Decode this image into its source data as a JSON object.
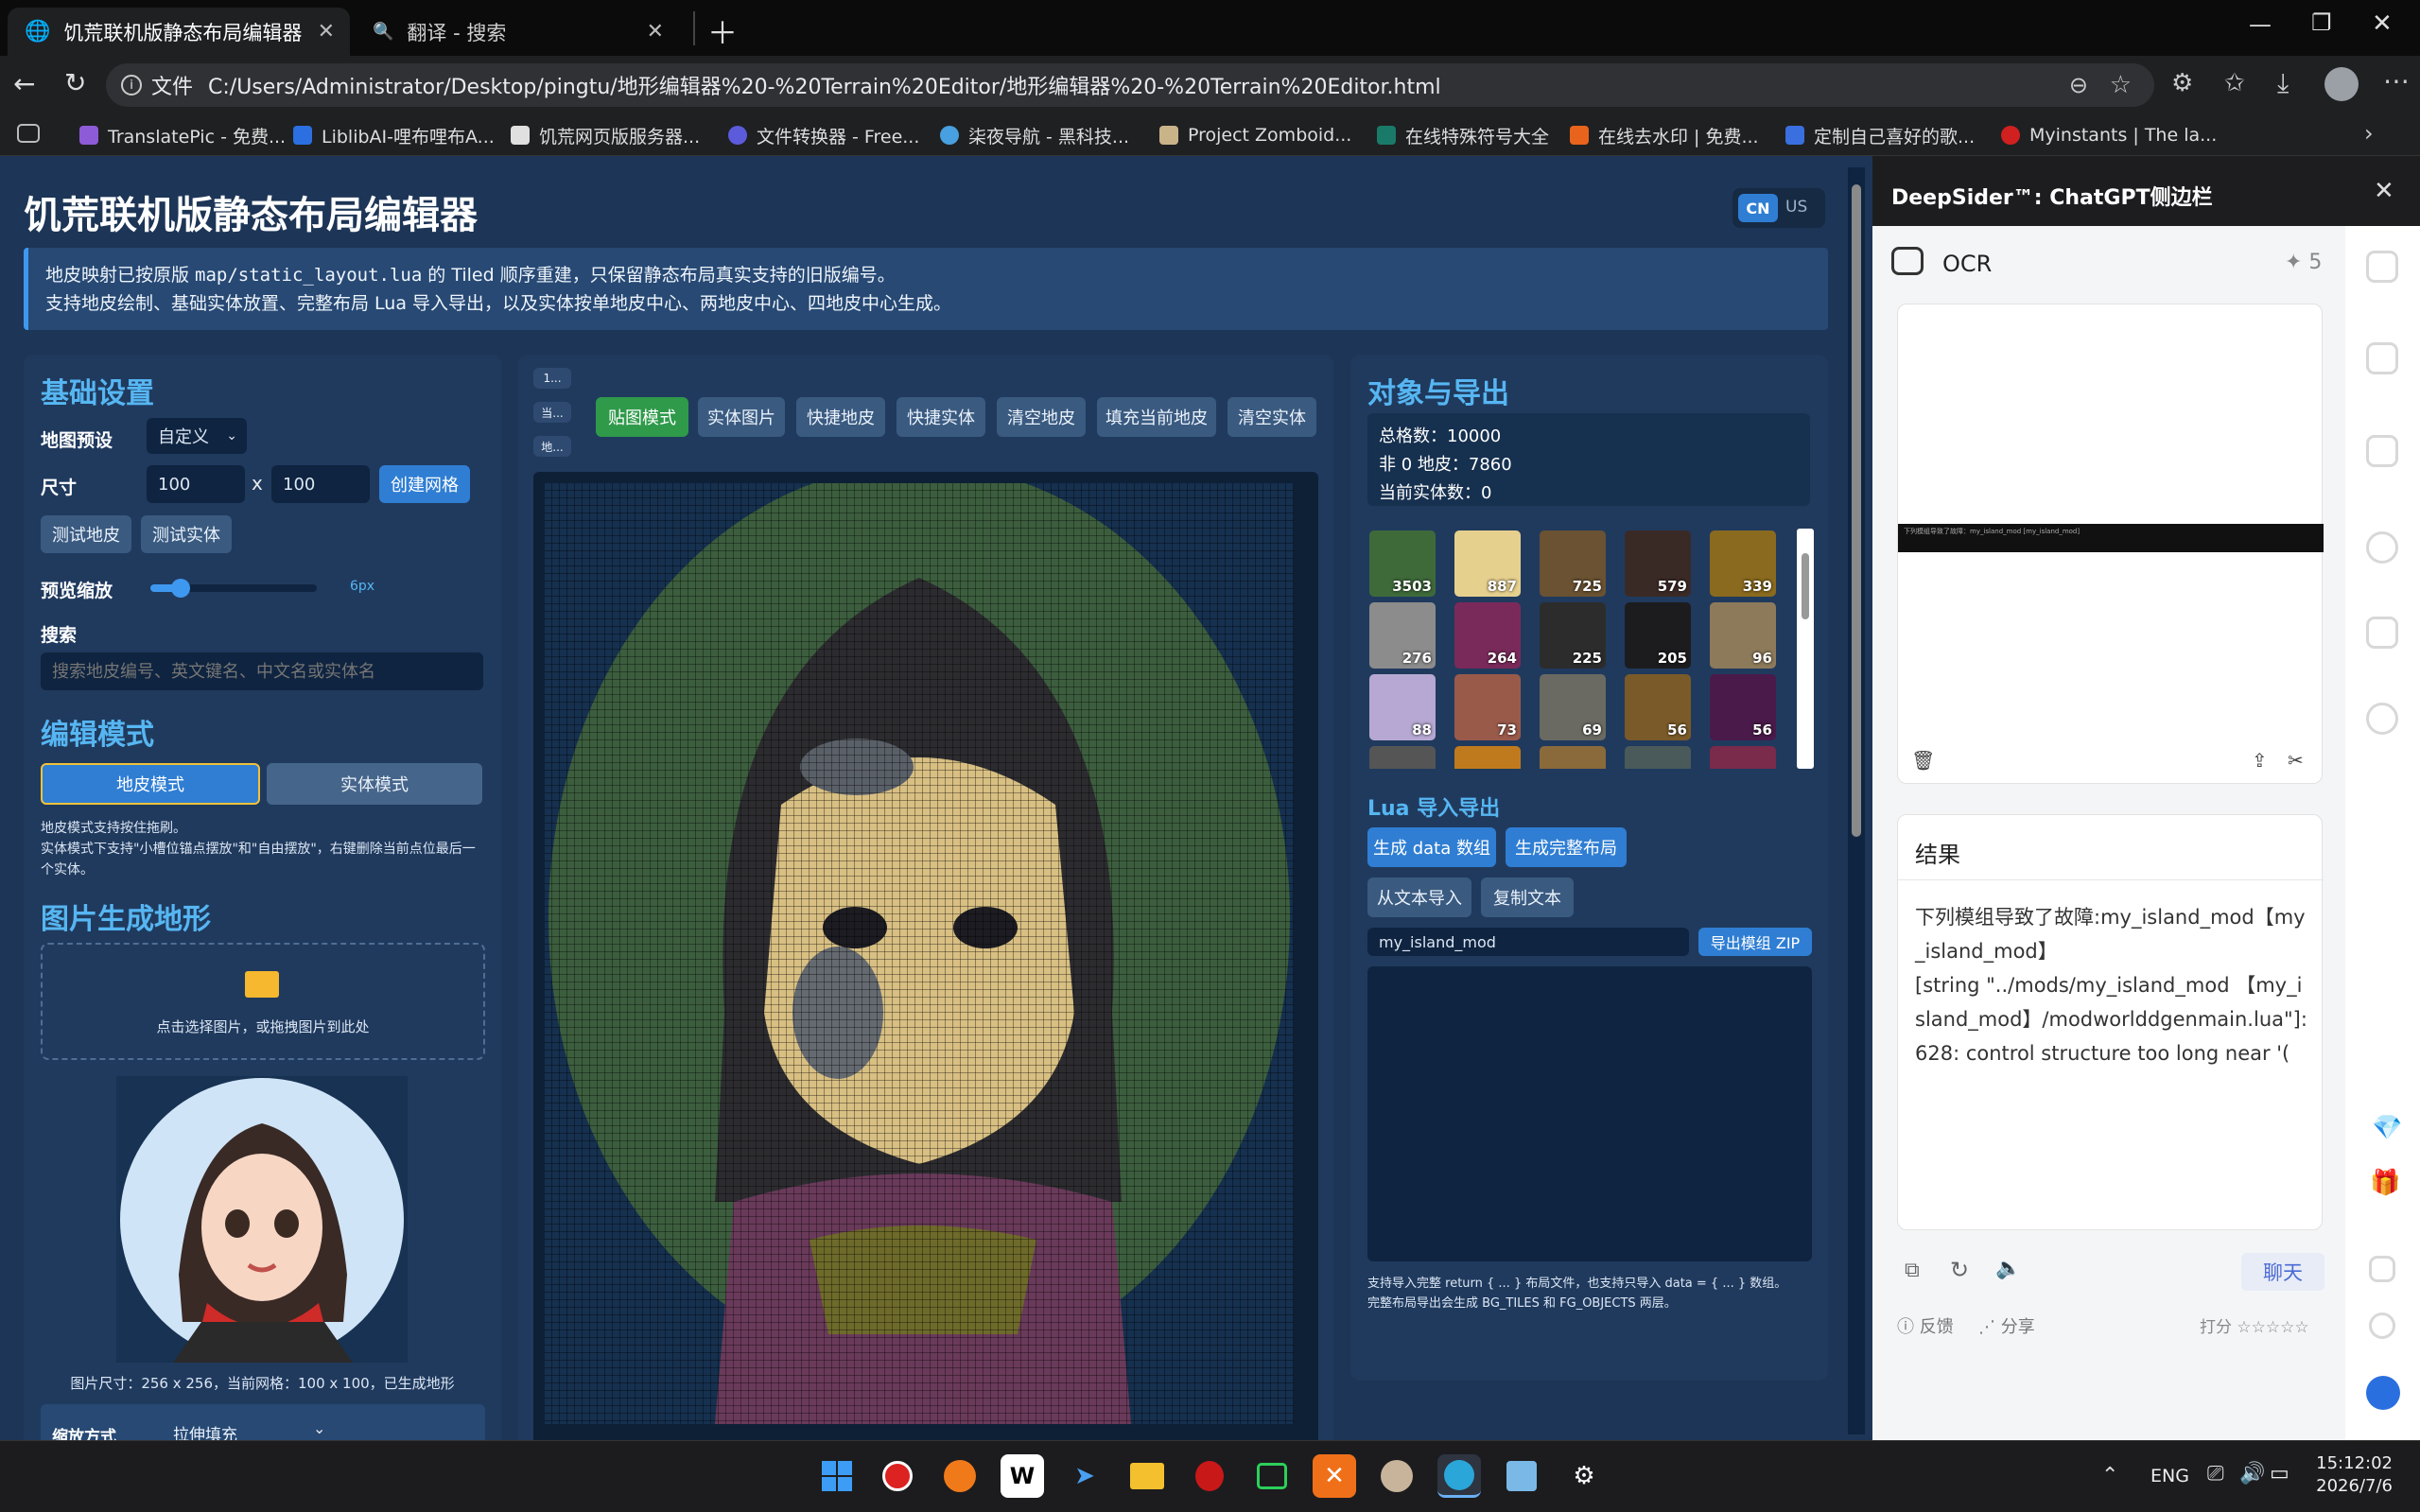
{
  "browser": {
    "tabs": [
      {
        "title": "饥荒联机版静态布局编辑器",
        "active": true
      },
      {
        "title": "翻译 - 搜索",
        "active": false
      }
    ],
    "address_prefix": "文件",
    "url": "C:/Users/Administrator/Desktop/pingtu/地形编辑器%20-%20Terrain%20Editor/地形编辑器%20-%20Terrain%20Editor.html",
    "bookmarks": [
      {
        "label": "TranslatePic - 免费...",
        "color": "#8e5bd8"
      },
      {
        "label": "LiblibAI-哩布哩布A...",
        "color": "#2b6fe0"
      },
      {
        "label": "饥荒网页版服务器...",
        "color": "#e0e0e0"
      },
      {
        "label": "文件转换器 - Free...",
        "color": "#5b5bdb"
      },
      {
        "label": "柒夜导航 - 黑科技...",
        "color": "#48a0e0"
      },
      {
        "label": "Project Zomboid...",
        "color": "#c9b48a"
      },
      {
        "label": "在线特殊符号大全",
        "color": "#1a7a6a"
      },
      {
        "label": "在线去水印 | 免费...",
        "color": "#e8641c"
      },
      {
        "label": "定制自己喜好的歌...",
        "color": "#3a6fe0"
      },
      {
        "label": "Myinstants | The la...",
        "color": "#d02020"
      }
    ]
  },
  "app": {
    "title": "饥荒联机版静态布局编辑器",
    "lang": {
      "cn": "CN",
      "us": "US"
    },
    "notice": {
      "line1_a": "地皮映射已按原版 ",
      "line1_code": "map/static_layout.lua",
      "line1_b": " 的 Tiled 顺序重建，只保留静态布局真实支持的旧版编号。",
      "line2": "支持地皮绘制、基础实体放置、完整布局 Lua 导入导出，以及实体按单地皮中心、两地皮中心、四地皮中心生成。"
    },
    "basic": {
      "heading": "基础设置",
      "preset_label": "地图预设",
      "preset_value": "自定义",
      "size_label": "尺寸",
      "width": "100",
      "x": "x",
      "height": "100",
      "create_grid": "创建网格",
      "test_turf": "测试地皮",
      "test_entity": "测试实体",
      "zoom_label": "预览缩放",
      "zoom_value": "6px",
      "zoom_fraction": 0.18,
      "search_label": "搜索",
      "search_placeholder": "搜索地皮编号、英文键名、中文名或实体名"
    },
    "edit": {
      "heading": "编辑模式",
      "turf_mode": "地皮模式",
      "entity_mode": "实体模式",
      "note1": "地皮模式支持按住拖刷。",
      "note2": "实体模式下支持\"小槽位锚点摆放\"和\"自由摆放\"，右键删除当前点位最后一个实体。"
    },
    "image": {
      "heading": "图片生成地形",
      "drop_text": "点击选择图片，或拖拽图片到此处",
      "info": "图片尺寸：256 x 256，当前网格：100 x 100，已生成地形",
      "scale_label": "缩放方式",
      "scale_value": "拉伸填充"
    },
    "toolbar": {
      "mini": [
        "1...",
        "当...",
        "地..."
      ],
      "buttons": [
        "贴图模式",
        "实体图片",
        "快捷地皮",
        "快捷实体",
        "清空地皮",
        "填充当前地皮",
        "清空实体"
      ]
    },
    "objects": {
      "heading": "对象与导出",
      "total": "总格数：10000",
      "nonzero": "非 0 地皮：7860",
      "entities": "当前实体数：0",
      "tiles": [
        {
          "count": "3503",
          "color": "#3e6a3a"
        },
        {
          "count": "887",
          "color": "#e6d08e"
        },
        {
          "count": "725",
          "color": "#6a5232"
        },
        {
          "count": "579",
          "color": "#3a2a26"
        },
        {
          "count": "339",
          "color": "#8a6a1e"
        },
        {
          "count": "276",
          "color": "#8c8c8c"
        },
        {
          "count": "264",
          "color": "#7a2a5a"
        },
        {
          "count": "225",
          "color": "#2c2c2c"
        },
        {
          "count": "205",
          "color": "#1c1c1e"
        },
        {
          "count": "96",
          "color": "#8c7a5a"
        },
        {
          "count": "88",
          "color": "#b6a8d2"
        },
        {
          "count": "73",
          "color": "#9a5a4a"
        },
        {
          "count": "69",
          "color": "#6a6a62"
        },
        {
          "count": "56",
          "color": "#7a5a28"
        },
        {
          "count": "56",
          "color": "#4a1a4a"
        }
      ]
    },
    "lua": {
      "heading": "Lua 导入导出",
      "gen_data": "生成 data 数组",
      "gen_full": "生成完整布局",
      "import_text": "从文本导入",
      "copy_text": "复制文本",
      "mod_name": "my_island_mod",
      "export_zip": "导出模组 ZIP",
      "note1": "支持导入完整 return { ... } 布局文件，也支持只导入 data = { ... } 数组。",
      "note2": "完整布局导出会生成 BG_TILES 和 FG_OBJECTS 两层。"
    }
  },
  "sidebar": {
    "title": "DeepSider™: ChatGPT侧边栏",
    "ocr_label": "OCR",
    "credits": "✦ 5",
    "thumb_text": "下列模组导致了故障：my_island_mod [my_island_mod]",
    "result_label": "结果",
    "result_text": "下列模组导致了故障:my_island_mod【my_island_mod】\n[string \"../mods/my_island_mod 【my_island_mod】/modworlddgenmain.lua\"]:628: control structure too long near '(",
    "chat_button": "聊天",
    "feedback": "反馈",
    "share": "分享",
    "rate": "打分",
    "stars": "☆☆☆☆☆"
  },
  "taskbar": {
    "lang": "ENG",
    "time": "15:12:02",
    "date": "2026/7/6"
  }
}
